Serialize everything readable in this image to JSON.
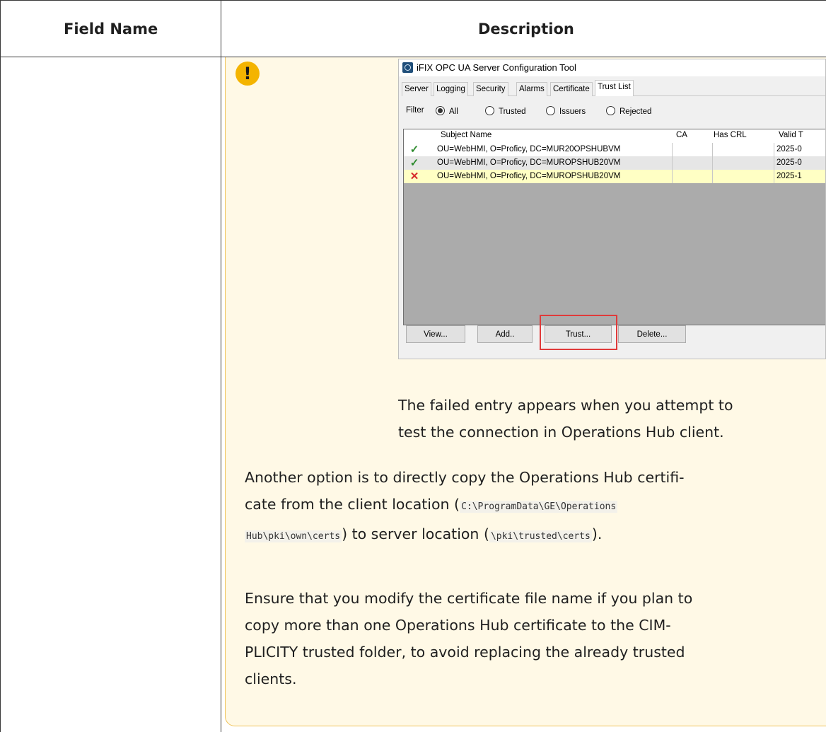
{
  "table": {
    "header_field": "Field Name",
    "header_description": "Description"
  },
  "note": {
    "icon": "exclamation-icon",
    "accent_color": "#f4b400",
    "background_color": "#fff9e6"
  },
  "screenshot": {
    "title": "iFIX OPC UA Server Configuration Tool",
    "tabs": [
      "Server",
      "Logging",
      "Security",
      "Alarms",
      "Certificate",
      "Trust List"
    ],
    "active_tab": "Trust List",
    "filter_label": "Filter",
    "filter_options": [
      "All",
      "Trusted",
      "Issuers",
      "Rejected"
    ],
    "selected_filter": "All",
    "columns": [
      "Subject Name",
      "CA",
      "Has CRL",
      "Valid T"
    ],
    "rows": [
      {
        "status": "✓",
        "subject": "OU=WebHMI, O=Proficy, DC=MUR20OPSHUBVM",
        "ca": "",
        "has_crl": "",
        "valid": "2025-0"
      },
      {
        "status": "✓",
        "subject": "OU=WebHMI, O=Proficy, DC=MUROPSHUB20VM",
        "ca": "",
        "has_crl": "",
        "valid": "2025-0"
      },
      {
        "status": "✕",
        "subject": "OU=WebHMI, O=Proficy, DC=MUROPSHUB20VM",
        "ca": "",
        "has_crl": "",
        "valid": "2025-1"
      }
    ],
    "buttons": [
      "View...",
      "Add..",
      "Trust...",
      "Delete..."
    ],
    "highlighted_button": "Trust..."
  },
  "text": {
    "failed_entry_line1": "The failed entry appears when you attempt to",
    "failed_entry_line2": "test the connection in Operations Hub client.",
    "copy_line1": "Another option is to directly copy the Operations Hub certifi-",
    "copy_line2_a": "cate from the client location (",
    "copy_line2_code": "C:\\ProgramData\\GE\\Operations",
    "copy_line3_code1": "Hub\\pki\\own\\certs",
    "copy_line3_b": ") to server location (",
    "copy_line3_code2": "\\pki\\trusted\\certs",
    "copy_line3_c": ").",
    "ensure_line1": "Ensure that you modify the certificate file name if you plan to",
    "ensure_line2": "copy more than one Operations Hub certificate to the CIM-",
    "ensure_line3": "PLICITY trusted folder, to avoid replacing the already trusted",
    "ensure_line4": "clients."
  }
}
